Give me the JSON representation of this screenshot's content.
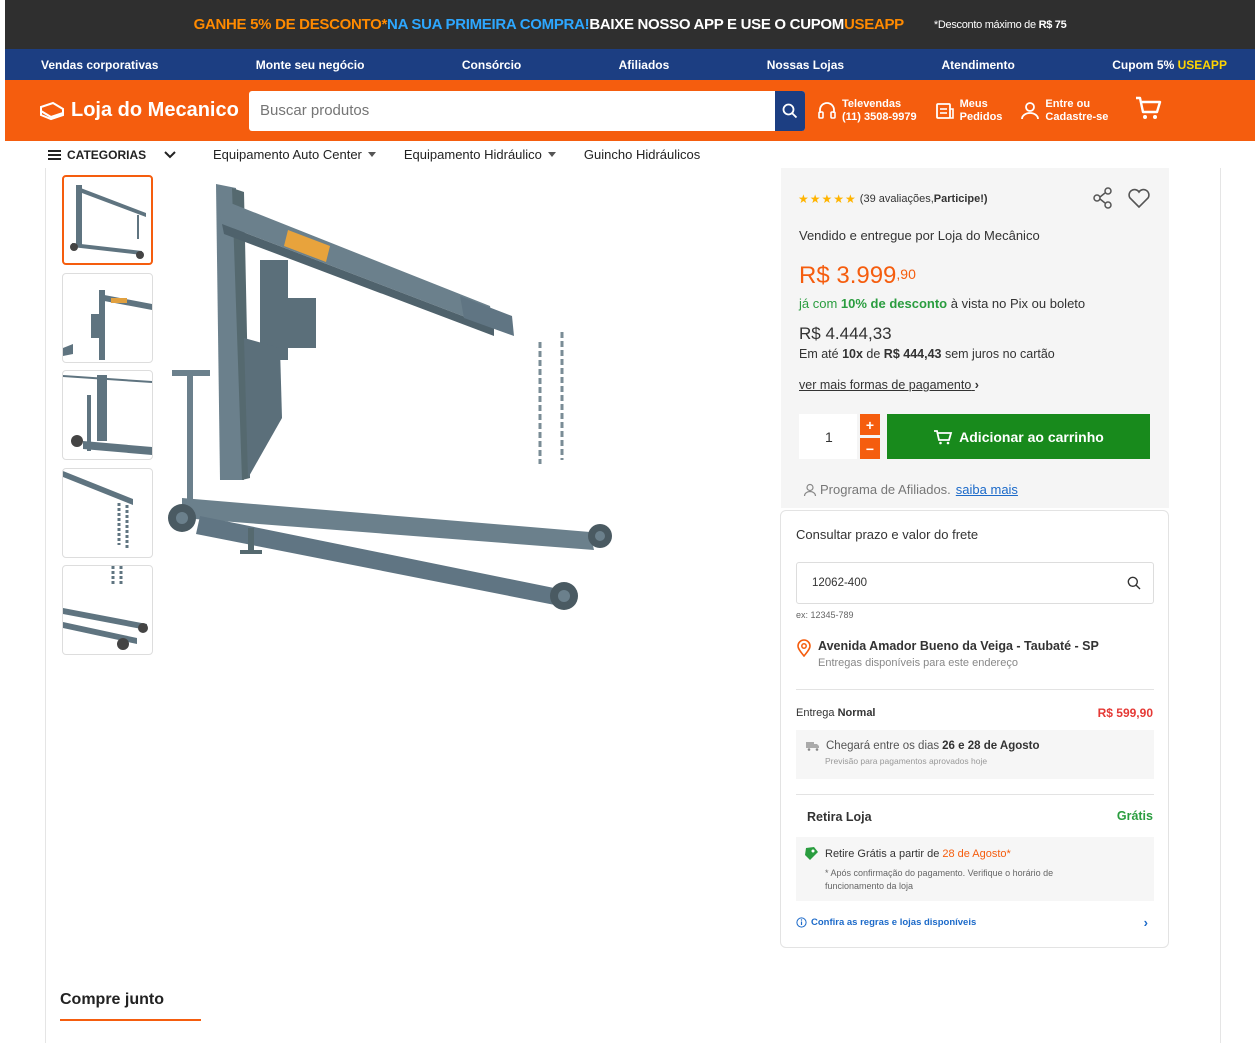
{
  "promo": {
    "part1": "GANHE 5% DE DESCONTO*",
    "part2": " NA SUA PRIMEIRA COMPRA!",
    "part3": " BAIXE NOSSO APP E USE O CUPOM ",
    "part4": "USEAPP",
    "note": "*Desconto máximo de ",
    "note_value": "R$ 75"
  },
  "nav": {
    "items": [
      "Vendas corporativas",
      "Monte seu negócio",
      "Consórcio",
      "Afiliados",
      "Nossas Lojas",
      "Atendimento"
    ],
    "coupon_label": "Cupom 5% ",
    "coupon_code": "USEAPP"
  },
  "header": {
    "logo": "Loja do Mecanico",
    "search_placeholder": "Buscar produtos",
    "televendas_label": "Televendas",
    "televendas_phone": "(11) 3508-9979",
    "pedidos_l1": "Meus",
    "pedidos_l2": "Pedidos",
    "account_l1": "Entre ou",
    "account_l2": "Cadastre-se"
  },
  "catbar": {
    "categories": "CATEGORIAS",
    "items": [
      "Equipamento Auto Center",
      "Equipamento Hidráulico",
      "Guincho Hidráulicos"
    ]
  },
  "product": {
    "rating_count": "(39 avaliações, ",
    "rating_participate": "Participe!)",
    "seller_prefix": "Vendido e entregue por ",
    "seller_name": "Loja do Mecânico",
    "price_main": "R$ 3.999",
    "price_cents": ",90",
    "pix_prefix": "já com ",
    "pix_discount": "10% de desconto",
    "pix_suffix": " à vista no Pix ou boleto",
    "old_price": "R$ 4.444,33",
    "inst_prefix": "Em até ",
    "inst_times": "10x",
    "inst_mid": " de ",
    "inst_value": "R$ 444,43",
    "inst_suffix": " sem juros no cartão",
    "more_payment": "ver mais formas de pagamento",
    "quantity": "1",
    "add_to_cart": "Adicionar ao carrinho",
    "affiliates_text": "Programa de Afiliados.",
    "affiliates_link": "saiba mais"
  },
  "shipping": {
    "title": "Consultar prazo e valor do frete",
    "cep_value": "12062-400",
    "cep_example": "ex: 12345-789",
    "address": "Avenida Amador Bueno da Veiga - Taubaté - SP",
    "address_note": "Entregas disponíveis para este endereço",
    "delivery_label": "Entrega ",
    "delivery_type": "Normal",
    "delivery_price": "R$ 599,90",
    "arrival_prefix": "Chegará entre os dias",
    "arrival_dates": "26 e 28 de Agosto",
    "arrival_note": "Previsão para pagamentos aprovados hoje",
    "pickup_label": "Retira Loja",
    "pickup_price": "Grátis",
    "pickup_text": "Retire Grátis a partir de",
    "pickup_date": "28 de Agosto*",
    "pickup_note": "* Após confirmação do pagamento. Verifique o horário de funcionamento da loja",
    "rules_link": "Confira as regras e lojas disponíveis"
  },
  "section": {
    "compre_junto": "Compre junto"
  },
  "colors": {
    "orange": "#f55d0e",
    "navy": "#1c3e82",
    "green": "#188a1c",
    "crane": "#5f7480"
  }
}
